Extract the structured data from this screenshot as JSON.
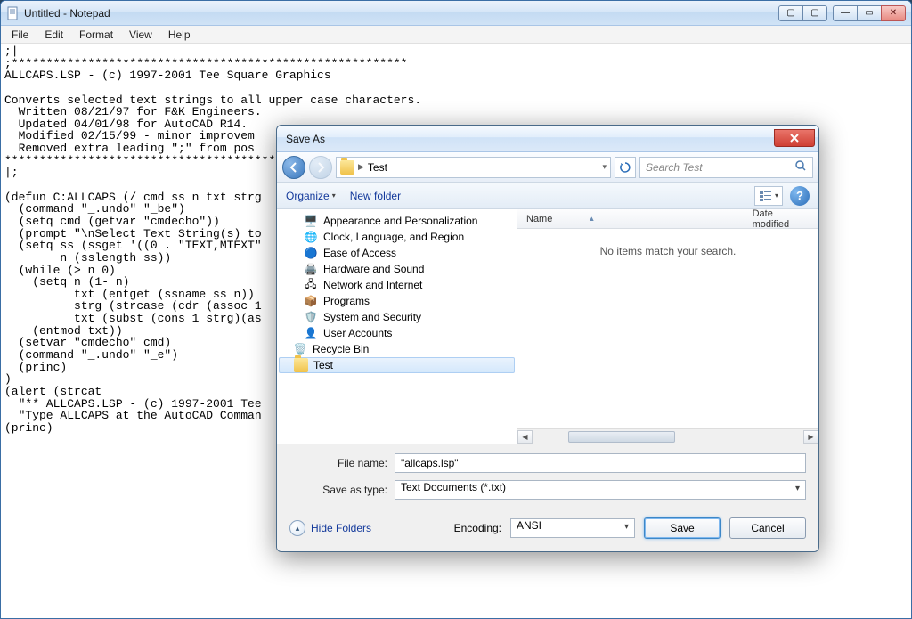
{
  "notepad": {
    "title": "Untitled - Notepad",
    "menu": {
      "file": "File",
      "edit": "Edit",
      "format": "Format",
      "view": "View",
      "help": "Help"
    },
    "content": ";|\n;*********************************************************\nALLCAPS.LSP - (c) 1997-2001 Tee Square Graphics\n\nConverts selected text strings to all upper case characters.\n  Written 08/21/97 for F&K Engineers.\n  Updated 04/01/98 for AutoCAD R14.\n  Modified 02/15/99 - minor improvem\n  Removed extra leading \";\" from pos\n*********************************************************\n|;\n\n(defun C:ALLCAPS (/ cmd ss n txt strg\n  (command \"_.undo\" \"_be\")\n  (setq cmd (getvar \"cmdecho\"))\n  (prompt \"\\nSelect Text String(s) to\n  (setq ss (ssget '((0 . \"TEXT,MTEXT\"\n        n (sslength ss))\n  (while (> n 0)\n    (setq n (1- n)\n          txt (entget (ssname ss n))\n          strg (strcase (cdr (assoc 1\n          txt (subst (cons 1 strg)(as\n    (entmod txt))\n  (setvar \"cmdecho\" cmd)\n  (command \"_.undo\" \"_e\")\n  (princ)\n)\n(alert (strcat\n  \"** ALLCAPS.LSP - (c) 1997-2001 Tee\n  \"Type ALLCAPS at the AutoCAD Comman\n(princ)"
  },
  "saveas": {
    "title": "Save As",
    "breadcrumb": "Test",
    "search_placeholder": "Search Test",
    "organize": "Organize",
    "newfolder": "New folder",
    "tree": {
      "items": [
        "Appearance and Personalization",
        "Clock, Language, and Region",
        "Ease of Access",
        "Hardware and Sound",
        "Network and Internet",
        "Programs",
        "System and Security",
        "User Accounts",
        "Recycle Bin",
        "Test"
      ]
    },
    "columns": {
      "name": "Name",
      "date": "Date modified"
    },
    "empty": "No items match your search.",
    "filename_label": "File name:",
    "filename_value": "\"allcaps.lsp\"",
    "savetype_label": "Save as type:",
    "savetype_value": "Text Documents (*.txt)",
    "hide_folders": "Hide Folders",
    "encoding_label": "Encoding:",
    "encoding_value": "ANSI",
    "save": "Save",
    "cancel": "Cancel"
  }
}
